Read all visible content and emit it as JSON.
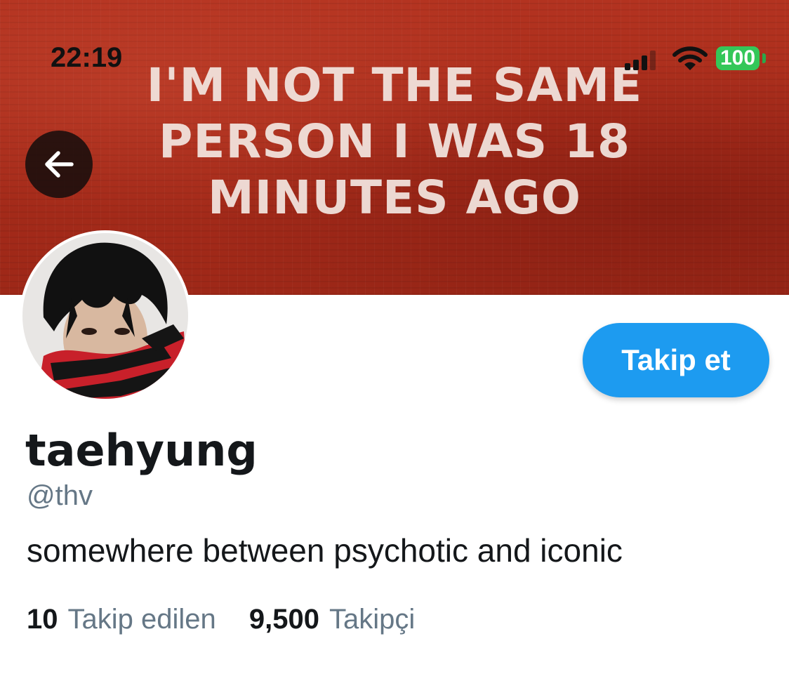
{
  "status_bar": {
    "time": "22:19",
    "battery": "100",
    "colors": {
      "battery": "#34c759"
    }
  },
  "banner": {
    "lines": [
      "I'M NOT THE SAME",
      "PERSON I WAS 18",
      "MINUTES AGO"
    ],
    "colors": {
      "background": "#a72b1a",
      "text": "#f3e6e0"
    }
  },
  "navigation": {
    "back_icon": "arrow-left-icon"
  },
  "profile": {
    "display_name": "taehyung",
    "handle": "@thv",
    "bio": "somewhere between psychotic and iconic",
    "follow_label": "Takip et",
    "colors": {
      "accent": "#1d9bf0",
      "secondary_text": "#657786"
    }
  },
  "stats": {
    "following_count": "10",
    "following_label": "Takip edilen",
    "followers_count": "9,500",
    "followers_label": "Takipçi"
  }
}
